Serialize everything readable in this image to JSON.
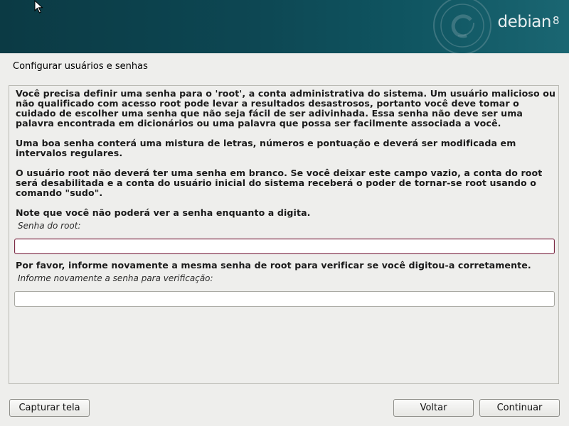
{
  "banner": {
    "logo_text": "debian",
    "logo_version": "8",
    "colors": {
      "background": "#0d4753",
      "logo": "#e8eef0"
    },
    "swirl_icon": "debian-swirl-icon"
  },
  "page": {
    "title": "Configurar usuários e senhas"
  },
  "content": {
    "paragraphs": [
      "Você precisa definir uma senha para o 'root', a conta administrativa do sistema. Um usuário malicioso ou não qualificado com acesso root pode levar a resultados desastrosos, portanto você deve tomar o cuidado de escolher uma senha que não seja fácil de ser adivinhada. Essa senha não deve ser uma palavra encontrada em dicionários ou uma palavra que possa ser facilmente associada a você.",
      "Uma boa senha conterá uma mistura de letras, números e pontuação e deverá ser modificada em intervalos regulares.",
      "O usuário root não deverá ter uma senha em branco. Se você deixar este campo vazio, a conta do root será desabilitada e a conta do usuário inicial do sistema receberá o poder de tornar-se root usando o comando \"sudo\".",
      "Note que você não poderá ver a senha enquanto a digita."
    ],
    "root_password": {
      "label": "Senha do root:",
      "value": ""
    },
    "verify_prompt": "Por favor, informe novamente a mesma senha de root para verificar se você digitou-a corretamente.",
    "verify_password": {
      "label": "Informe novamente a senha para verificação:",
      "value": ""
    }
  },
  "buttons": {
    "screenshot": "Capturar tela",
    "back": "Voltar",
    "continue": "Continuar"
  },
  "colors": {
    "focus_border": "#7d2a45",
    "panel_bg": "#eeeeec"
  }
}
